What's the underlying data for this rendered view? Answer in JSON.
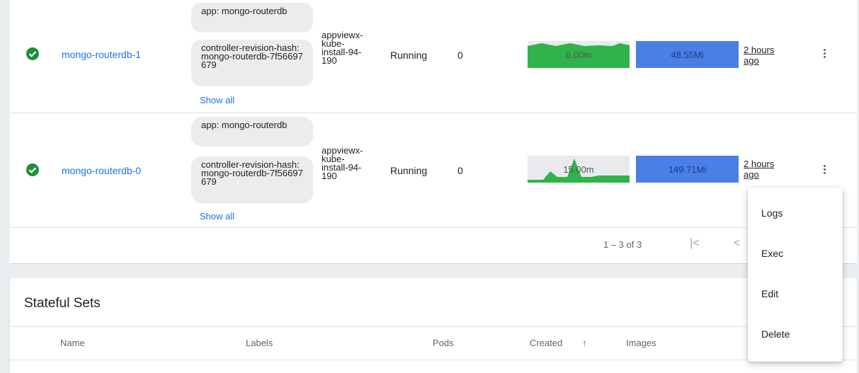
{
  "pods": [
    {
      "name": "mongo-routerdb-1",
      "labels": [
        "app: mongo-routerdb",
        "controller-revision-hash: mongo-routerdb-7f56697679"
      ],
      "show_all": "Show all",
      "node": "appviewx-kube-install-94-190",
      "phase": "Running",
      "restarts": "0",
      "cpu": "6.00m",
      "memory": "48.55Mi",
      "age": "2 hours ago",
      "status_icon": "check-circle-icon"
    },
    {
      "name": "mongo-routerdb-0",
      "labels": [
        "app: mongo-routerdb",
        "controller-revision-hash: mongo-routerdb-7f56697679"
      ],
      "show_all": "Show all",
      "node": "appviewx-kube-install-94-190",
      "phase": "Running",
      "restarts": "0",
      "cpu": "15.00m",
      "memory": "149.71Mi",
      "age": "2 hours ago",
      "status_icon": "check-circle-icon"
    }
  ],
  "pagination": {
    "range": "1 – 3 of 3",
    "first": "|<",
    "prev": "<"
  },
  "stateful_sets": {
    "title": "Stateful Sets",
    "columns": {
      "name": "Name",
      "labels": "Labels",
      "pods": "Pods",
      "created": "Created",
      "sort_arrow": "↑",
      "images": "Images"
    }
  },
  "context_menu": {
    "items": [
      "Logs",
      "Exec",
      "Edit",
      "Delete"
    ]
  },
  "colors": {
    "accent": "#1a73e8",
    "success": "#1e8e3e",
    "cpu_fill": "#2fb34a",
    "memory_fill": "#4a7fe6"
  }
}
